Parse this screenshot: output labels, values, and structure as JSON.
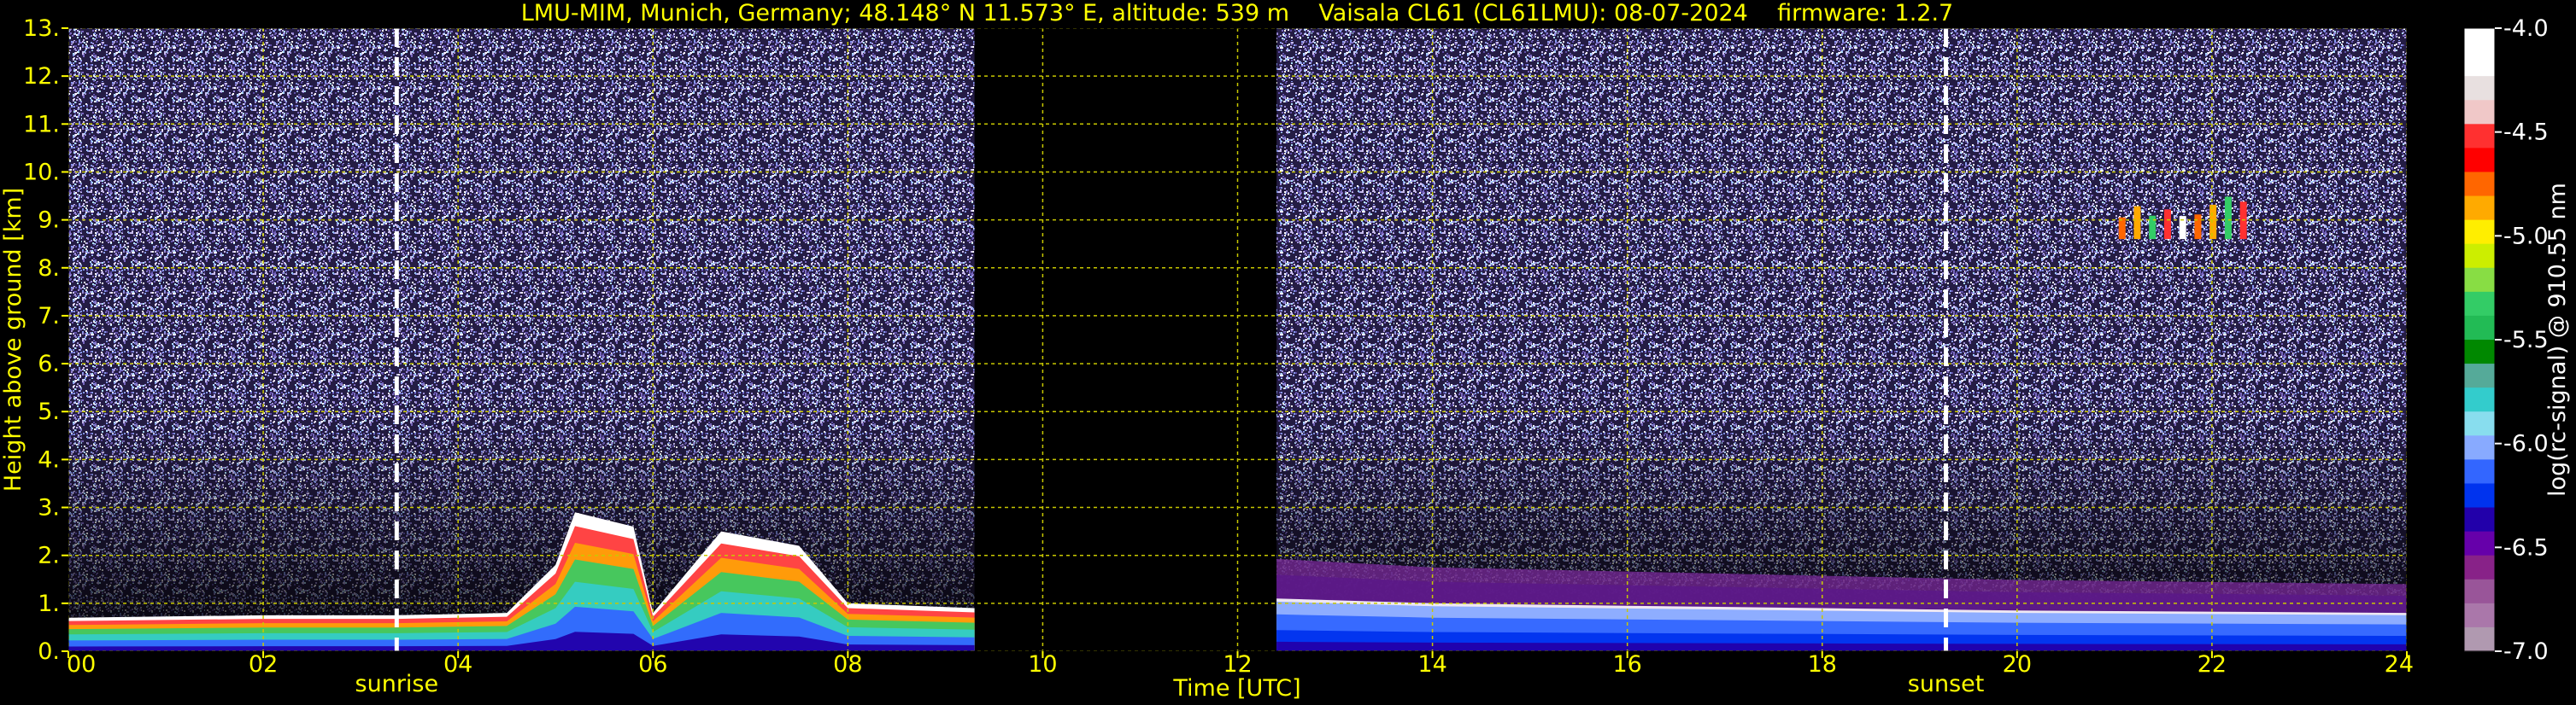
{
  "chart_data": {
    "type": "heatmap",
    "title": "LMU-MIM, Munich, Germany; 48.148° N 11.573° E, altitude: 539 m    Vaisala CL61 (CL61LMU): 08-07-2024    firmware: 1.2.7",
    "xlabel": "Time [UTC]",
    "ylabel": "Height above ground [km]",
    "xlim": [
      0,
      24
    ],
    "ylim": [
      0,
      13
    ],
    "x_ticks": [
      "00",
      "02",
      "04",
      "06",
      "08",
      "10",
      "12",
      "14",
      "16",
      "18",
      "20",
      "22",
      "24"
    ],
    "x_tick_values": [
      0,
      2,
      4,
      6,
      8,
      10,
      12,
      14,
      16,
      18,
      20,
      22,
      24
    ],
    "y_ticks": [
      "0.",
      "1.",
      "2.",
      "3.",
      "4.",
      "5.",
      "6.",
      "7.",
      "8.",
      "9.",
      "10.",
      "11.",
      "12.",
      "13."
    ],
    "y_tick_values": [
      0,
      1,
      2,
      3,
      4,
      5,
      6,
      7,
      8,
      9,
      10,
      11,
      12,
      13
    ],
    "grid": true,
    "annotations": [
      {
        "label": "sunrise",
        "x": 3.37
      },
      {
        "label": "sunset",
        "x": 19.27
      }
    ],
    "data_gaps": [
      [
        9.3,
        12.4
      ]
    ],
    "boundary_layer_top": [
      {
        "x": 0,
        "y": 0.7
      },
      {
        "x": 2,
        "y": 0.75
      },
      {
        "x": 3.37,
        "y": 0.75
      },
      {
        "x": 4.5,
        "y": 0.8
      },
      {
        "x": 5.0,
        "y": 1.8
      },
      {
        "x": 5.2,
        "y": 2.9
      },
      {
        "x": 5.8,
        "y": 2.6
      },
      {
        "x": 6.0,
        "y": 0.8
      },
      {
        "x": 6.7,
        "y": 2.5
      },
      {
        "x": 7.5,
        "y": 2.2
      },
      {
        "x": 8.0,
        "y": 1.0
      },
      {
        "x": 9.3,
        "y": 0.9
      },
      {
        "x": 12.4,
        "y": 1.1
      },
      {
        "x": 14,
        "y": 1.0
      },
      {
        "x": 16,
        "y": 0.95
      },
      {
        "x": 18,
        "y": 0.9
      },
      {
        "x": 20,
        "y": 0.85
      },
      {
        "x": 24,
        "y": 0.8
      }
    ],
    "cloud_features": [
      {
        "x_start": 21.0,
        "x_end": 22.4,
        "y_bottom": 8.6,
        "y_top": 9.5
      }
    ],
    "colorbar": {
      "label": "log(rc-signal) @ 910.55 nm",
      "range": [
        -7.0,
        -4.0
      ],
      "ticks": [
        "-4.0",
        "-4.5",
        "-5.0",
        "-5.5",
        "-6.0",
        "-6.5",
        "-7.0"
      ],
      "tick_values": [
        -4.0,
        -4.5,
        -5.0,
        -5.5,
        -6.0,
        -6.5,
        -7.0
      ]
    },
    "colors": {
      "background": "#000000",
      "text": "#ffff00",
      "grid": "#c8c800",
      "noise": "#5a4a8a",
      "colormap": [
        "#ffffff",
        "#ffffff",
        "#e8e0e0",
        "#f0c8c8",
        "#ff3030",
        "#ff0000",
        "#ff6600",
        "#ffaa00",
        "#ffee00",
        "#ccee00",
        "#88dd44",
        "#33cc66",
        "#22bb55",
        "#008800",
        "#55aa99",
        "#33cccc",
        "#88ddee",
        "#88aaff",
        "#3366ff",
        "#0033ee",
        "#2200aa",
        "#6600aa",
        "#882288",
        "#995599",
        "#aa77aa",
        "#b099b0"
      ]
    }
  }
}
